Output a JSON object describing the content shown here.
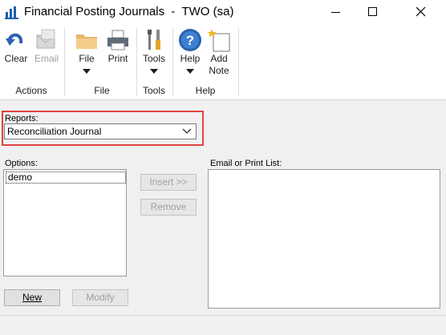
{
  "window": {
    "title": "Financial Posting Journals  -  TWO (sa)"
  },
  "ribbon": {
    "actions": {
      "clear": "Clear",
      "email": "Email",
      "group": "Actions"
    },
    "file": {
      "file": "File",
      "print": "Print",
      "group": "File"
    },
    "tools": {
      "tools": "Tools",
      "group": "Tools"
    },
    "help": {
      "help": "Help",
      "add_note_line1": "Add",
      "add_note_line2": "Note",
      "group": "Help"
    }
  },
  "form": {
    "reports_label": "Reports:",
    "reports_value": "Reconciliation Journal",
    "options_label": "Options:",
    "options_items": [
      "demo"
    ],
    "email_print_label": "Email or Print List:",
    "insert_button": "Insert >>",
    "remove_button": "Remove",
    "new_button": "New",
    "modify_button": "Modify"
  },
  "colors": {
    "highlight_border": "#e0443f",
    "help_blue": "#2a62b0"
  }
}
